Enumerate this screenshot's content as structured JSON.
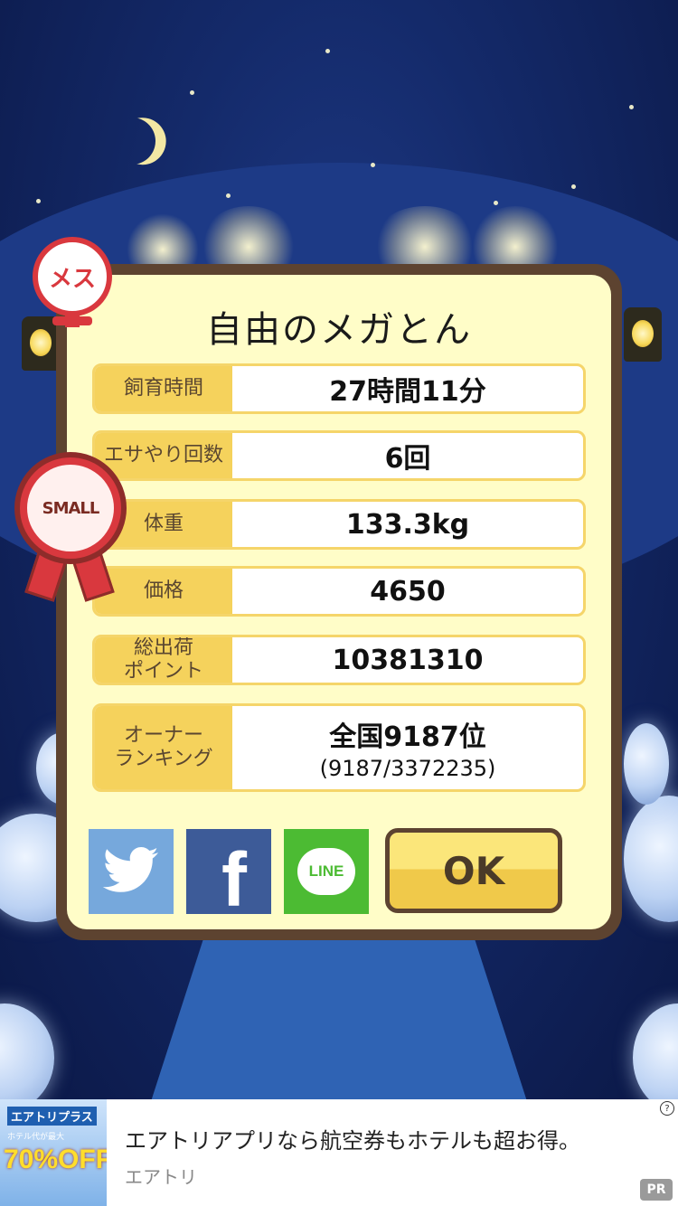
{
  "dialog": {
    "title": "自由のメガとん",
    "rows": [
      {
        "label": "飼育時間",
        "value": "27時間11分"
      },
      {
        "label": "エサやり回数",
        "value": "6回"
      },
      {
        "label": "体重",
        "value": "133.3kg"
      },
      {
        "label": "価格",
        "value": "4650"
      },
      {
        "label": "総出荷\nポイント",
        "value": "10381310"
      },
      {
        "label": "オーナー\nランキング",
        "value": "全国9187位",
        "sub": "(9187/3372235)"
      }
    ],
    "ok_label": "OK",
    "line_label": "LINE",
    "facebook_glyph": "f"
  },
  "badges": {
    "gender": "メス",
    "size": "SMALL"
  },
  "ad": {
    "brand": "エアトリプラス",
    "promo": "70%OFF!!",
    "small_text": "ホテル代が最大",
    "title": "エアトリアプリなら航空券もホテルも超お得。",
    "source": "エアトリ",
    "pr": "PR",
    "info": "?"
  },
  "icons": [
    "twitter-icon",
    "facebook-icon",
    "line-icon",
    "moon-icon",
    "female-symbol-icon",
    "rosette-icon"
  ],
  "colors": {
    "panel": "#fffdc8",
    "frame": "#5d4330",
    "label_bg": "#f5d25c",
    "accent_red": "#d9383e",
    "ok": "#fbe67a"
  }
}
